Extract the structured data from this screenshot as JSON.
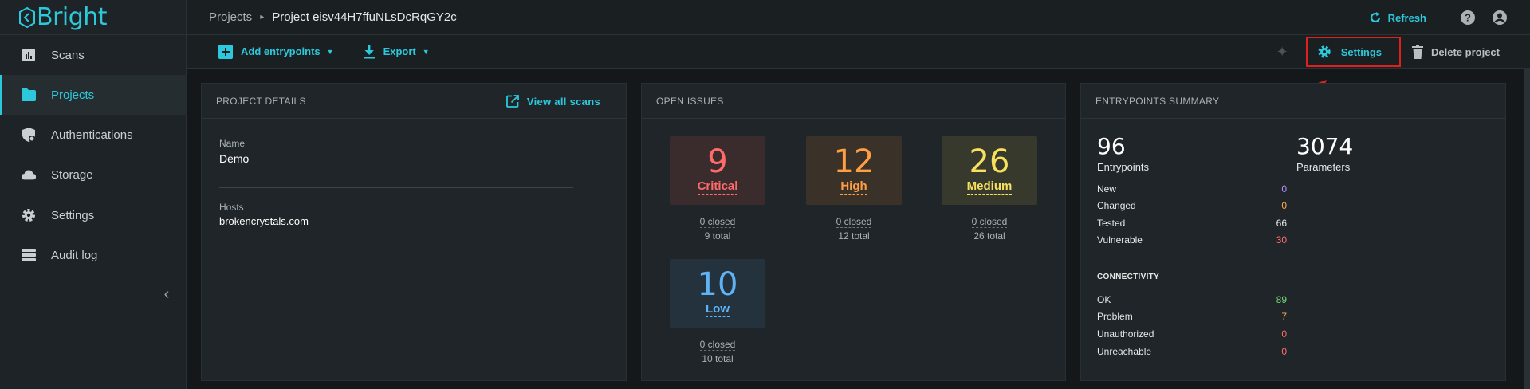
{
  "brand": {
    "name": "Bright",
    "color": "#2cc9dc"
  },
  "sidebar": {
    "items": [
      {
        "label": "Scans",
        "icon": "bar-chart-icon",
        "active": false
      },
      {
        "label": "Projects",
        "icon": "folder-icon",
        "active": true
      },
      {
        "label": "Authentications",
        "icon": "shield-lock-icon",
        "active": false
      },
      {
        "label": "Storage",
        "icon": "cloud-icon",
        "active": false
      },
      {
        "label": "Settings",
        "icon": "gear-icon",
        "active": false
      },
      {
        "label": "Audit log",
        "icon": "list-icon",
        "active": false
      }
    ],
    "collapse_glyph": "‹"
  },
  "header": {
    "breadcrumb_root": "Projects",
    "breadcrumb_sep": "▸",
    "breadcrumb_current": "Project eisv44H7ffuNLsDcRqGY2c",
    "refresh_label": "Refresh"
  },
  "toolbar": {
    "add_label": "Add entrypoints",
    "export_label": "Export",
    "settings_label": "Settings",
    "delete_label": "Delete project"
  },
  "details": {
    "title": "PROJECT DETAILS",
    "view_all": "View all scans",
    "name_label": "Name",
    "name_value": "Demo",
    "hosts_label": "Hosts",
    "hosts_value": "brokencrystals.com"
  },
  "issues": {
    "title": "OPEN ISSUES",
    "tiles": [
      {
        "count": "9",
        "name": "Critical",
        "closed": "0 closed",
        "total": "9 total",
        "color": "#ff6b6b",
        "bg": "#3a2b2d"
      },
      {
        "count": "12",
        "name": "High",
        "closed": "0 closed",
        "total": "12 total",
        "color": "#ff9f43",
        "bg": "#3a3128"
      },
      {
        "count": "26",
        "name": "Medium",
        "closed": "0 closed",
        "total": "26 total",
        "color": "#f6e05e",
        "bg": "#37392c"
      },
      {
        "count": "10",
        "name": "Low",
        "closed": "0 closed",
        "total": "10 total",
        "color": "#5fb3f5",
        "bg": "#24323d"
      }
    ]
  },
  "summary": {
    "title": "ENTRYPOINTS SUMMARY",
    "entrypoints_count": "96",
    "entrypoints_label": "Entrypoints",
    "parameters_count": "3074",
    "parameters_label": "Parameters",
    "status_rows": [
      {
        "label": "New",
        "value": "0",
        "color": "#b98cff"
      },
      {
        "label": "Changed",
        "value": "0",
        "color": "#ffa94d"
      },
      {
        "label": "Tested",
        "value": "66",
        "color": "#e6e9ea"
      },
      {
        "label": "Vulnerable",
        "value": "30",
        "color": "#ff6b6b"
      }
    ],
    "connectivity_title": "CONNECTIVITY",
    "connectivity_rows": [
      {
        "label": "OK",
        "value": "89",
        "color": "#6fd36f"
      },
      {
        "label": "Problem",
        "value": "7",
        "color": "#ffa94d"
      },
      {
        "label": "Unauthorized",
        "value": "0",
        "color": "#ff6b6b"
      },
      {
        "label": "Unreachable",
        "value": "0",
        "color": "#ff6b6b"
      }
    ]
  }
}
